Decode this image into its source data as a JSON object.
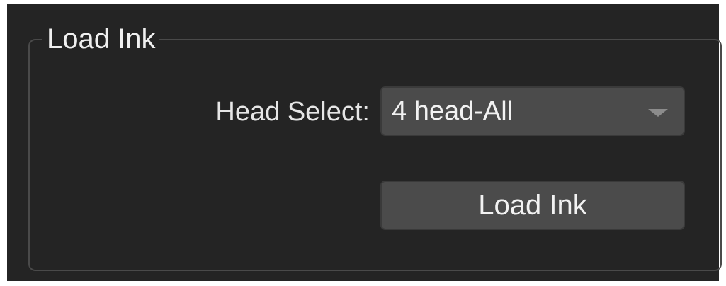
{
  "group": {
    "title": "Load Ink"
  },
  "head_select": {
    "label": "Head Select:",
    "value": "4 head-All",
    "dropdown_icon": "chevron-down-icon"
  },
  "actions": {
    "load_ink_label": "Load Ink"
  },
  "colors": {
    "background": "#242424",
    "control": "#4b4b4b",
    "text": "#f2f2f2",
    "border": "#4a4a4a"
  }
}
